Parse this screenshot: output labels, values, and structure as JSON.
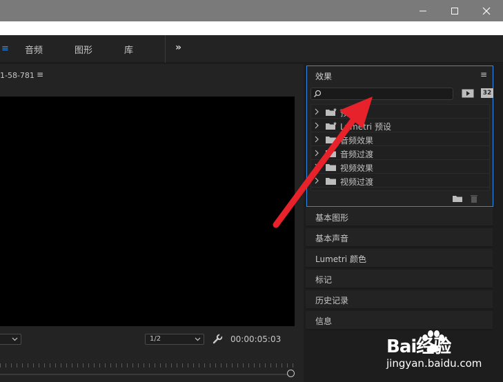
{
  "workspace": {
    "menu_icon": "≡",
    "tabs": [
      {
        "label": "音频"
      },
      {
        "label": "图形"
      },
      {
        "label": "库"
      }
    ],
    "more": "»"
  },
  "monitor": {
    "title": "1-58-781",
    "menu_icon": "≡",
    "resolution_value": "1/2",
    "timecode": "00:00:05:03"
  },
  "effects": {
    "title": "效果",
    "menu_icon": "≡",
    "search_placeholder": "",
    "badge_32": "32",
    "items": [
      {
        "label": "预设",
        "icon": "preset-folder-icon"
      },
      {
        "label": "Lumetri 预设",
        "icon": "preset-folder-icon"
      },
      {
        "label": "音频效果",
        "icon": "folder-icon"
      },
      {
        "label": "音频过渡",
        "icon": "folder-icon"
      },
      {
        "label": "视频效果",
        "icon": "folder-icon"
      },
      {
        "label": "视频过渡",
        "icon": "folder-icon"
      }
    ]
  },
  "panels": [
    {
      "label": "基本图形"
    },
    {
      "label": "基本声音"
    },
    {
      "label": "Lumetri 颜色"
    },
    {
      "label": "标记"
    },
    {
      "label": "历史记录"
    },
    {
      "label": "信息"
    }
  ],
  "watermark": {
    "brand": "Bai经验",
    "url": "jingyan.baidu.com"
  },
  "colors": {
    "accent": "#2d8ceb",
    "annotation_arrow": "#e8222a",
    "panel_bg": "#232323",
    "titlebar": "#7a7a7a"
  }
}
